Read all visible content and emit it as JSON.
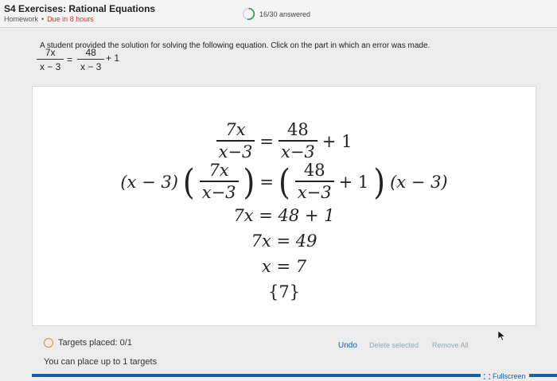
{
  "header": {
    "title": "S4 Exercises: Rational Equations",
    "type": "Homework",
    "separator": "•",
    "due": "Due in 8 hours",
    "progress_text": "16/30 answered",
    "progress_fraction": 0.533
  },
  "question": {
    "prompt": "A student provided the solution for solving the following equation. Click on the part in which an error was made.",
    "equation": {
      "lhs_num": "7x",
      "lhs_den": "x − 3",
      "eq": "=",
      "rhs_num": "48",
      "rhs_den": "x − 3",
      "plus_one": "+ 1"
    }
  },
  "steps": {
    "s1": {
      "lhs_num": "7x",
      "lhs_den": "x−3",
      "eq": "=",
      "rhs_num": "48",
      "rhs_den": "x−3",
      "tail": "+ 1"
    },
    "s2": {
      "lead": "(x − 3)",
      "open": "(",
      "num": "7x",
      "den": "x−3",
      "close": ")",
      "eq": "=",
      "open2": "(",
      "num2": "48",
      "den2": "x−3",
      "plus": "+ 1",
      "close2": ")",
      "trail": "(x − 3)"
    },
    "s3": "7x = 48 + 1",
    "s4": "7x = 49",
    "s5": "x = 7",
    "s6": "{7}"
  },
  "footer": {
    "targets_label": "Targets placed: 0/1",
    "limit_text": "You can place up to 1 targets",
    "undo": "Undo",
    "delete_selected": "Delete selected",
    "remove_all": "Remove All",
    "fullscreen": "Fullscreen"
  },
  "colors": {
    "accent": "#1a5fa8",
    "progress": "#2e9e4f",
    "radio": "#e08d2a",
    "due": "#c0392b"
  },
  "icons": {
    "progress": "progress-ring-icon",
    "target": "target-radio-icon",
    "cursor": "mouse-cursor-icon",
    "fullscreen": "fullscreen-icon"
  }
}
